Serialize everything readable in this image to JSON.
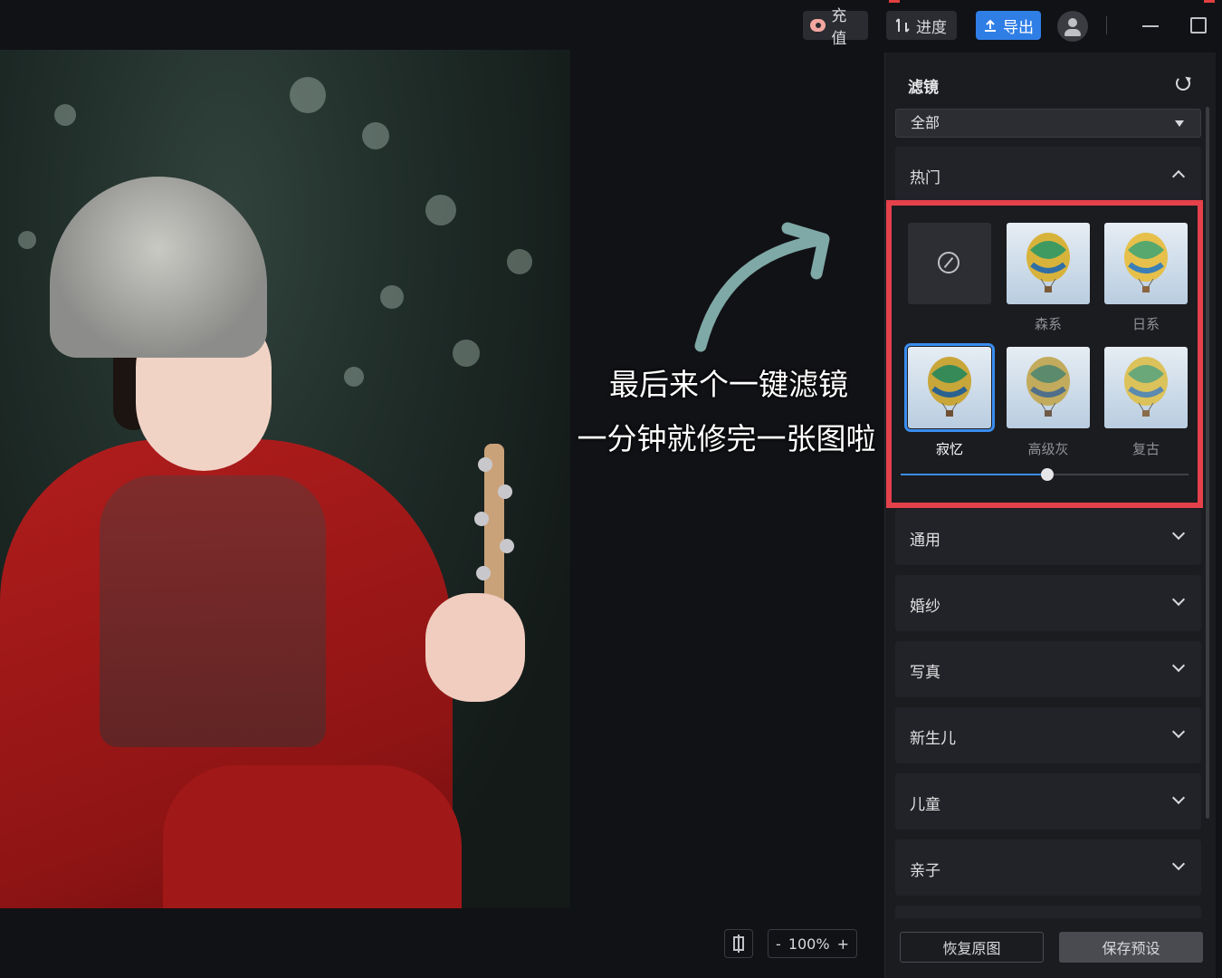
{
  "topbar": {
    "recharge_label": "充值",
    "progress_label": "进度",
    "export_label": "导出"
  },
  "caption": {
    "line1": "最后来个一键滤镜",
    "line2": "一分钟就修完一张图啦"
  },
  "toolbar": {
    "zoom_minus": "-",
    "zoom_level": "100%",
    "zoom_plus": "+"
  },
  "panel": {
    "title": "滤镜",
    "category_select": "全部",
    "hot_section": "热门",
    "filters": [
      {
        "name": ""
      },
      {
        "name": "森系"
      },
      {
        "name": "日系"
      },
      {
        "name": "寂忆"
      },
      {
        "name": "高级灰"
      },
      {
        "name": "复古"
      }
    ],
    "selected_filter": "寂忆",
    "intensity": 0.51,
    "sections": [
      "通用",
      "婚纱",
      "写真",
      "新生儿",
      "儿童",
      "亲子"
    ],
    "restore_button": "恢复原图",
    "save_button": "保存预设"
  },
  "colors": {
    "accent": "#2f7ee6",
    "highlight_box": "#e4414b",
    "annotation_arrow": "#7fa9a6"
  }
}
